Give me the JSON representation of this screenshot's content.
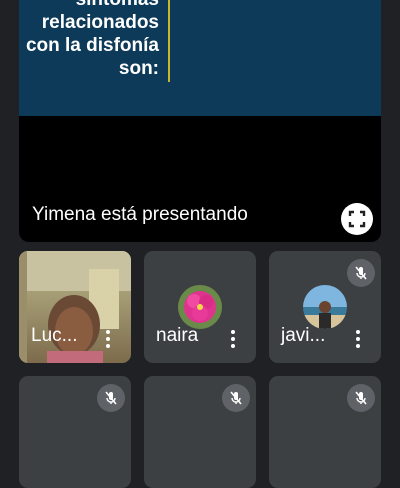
{
  "presentation": {
    "slide_lines": [
      "síntomas",
      "relacionados",
      "con la disfonía",
      "son:"
    ],
    "presenter_label": "Yimena está presentando",
    "slide_color": "#0e3a5a",
    "accent_bar_color": "#c8b62c"
  },
  "participants": [
    {
      "name": "Luc...",
      "video": true,
      "muted": false
    },
    {
      "name": "naira",
      "video": false,
      "muted": false,
      "avatar_icon": "pink-flower-avatar"
    },
    {
      "name": "javi...",
      "video": false,
      "muted": true,
      "avatar_icon": "beach-photo-avatar"
    },
    {
      "name": "",
      "muted": true
    },
    {
      "name": "",
      "muted": true
    },
    {
      "name": "",
      "muted": true
    }
  ],
  "icons": {
    "fullscreen": "fullscreen-icon",
    "more": "more-vert-icon",
    "mic_off": "mic-off-icon"
  },
  "colors": {
    "background": "#202124",
    "tile": "#3c4043",
    "mic_badge": "#5f6368"
  }
}
